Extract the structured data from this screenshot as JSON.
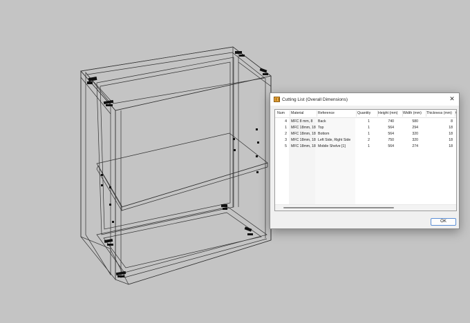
{
  "dialog": {
    "title": "Cutting List (Overall Dimensions)",
    "close_glyph": "✕",
    "ok_label": "OK",
    "columns": [
      "Num",
      "Material",
      "Reference",
      "Quantity",
      "Height (mm)",
      "Width (mm)",
      "Thickness (mm)",
      "G"
    ],
    "rows": [
      {
        "num": "4",
        "material": "MFC 8 mm, 8",
        "reference": "Back",
        "quantity": "1",
        "height": "740",
        "width": "580",
        "thickness": "8"
      },
      {
        "num": "1",
        "material": "MFC 18mm, 18",
        "reference": "Top",
        "quantity": "1",
        "height": "564",
        "width": "294",
        "thickness": "18"
      },
      {
        "num": "2",
        "material": "MFC 18mm, 18",
        "reference": "Bottom",
        "quantity": "1",
        "height": "564",
        "width": "320",
        "thickness": "18"
      },
      {
        "num": "3",
        "material": "MFC 18mm, 18",
        "reference": "Left Side, Right Side",
        "quantity": "2",
        "height": "750",
        "width": "320",
        "thickness": "18"
      },
      {
        "num": "5",
        "material": "MFC 18mm, 18",
        "reference": "Mobile Shelve [1]",
        "quantity": "1",
        "height": "564",
        "width": "274",
        "thickness": "18"
      }
    ]
  },
  "colors": {
    "background": "#c4c4c4",
    "wireframe": "#2a2a2a",
    "hardware": "#111111",
    "dialog_bg": "#f0f0f0",
    "ok_border": "#5a8ed6"
  }
}
